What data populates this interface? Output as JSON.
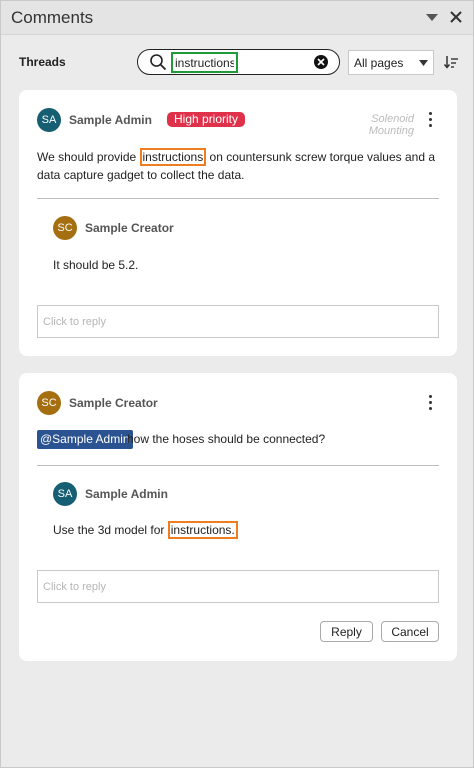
{
  "panel": {
    "title": "Comments",
    "collapse_icon": "triangle-down-icon",
    "close_icon": "close-icon"
  },
  "toolbar": {
    "threads_label": "Threads",
    "search_value": "instructions",
    "page_filter": "All pages"
  },
  "threads": [
    {
      "author_initials": "SA",
      "author": "Sample Admin",
      "priority": "High priority",
      "page_ref": "Solenoid Mounting",
      "text_before": "We should provide ",
      "text_match": "instructions",
      "text_after": " on countersunk screw torque values and a data capture gadget to collect the data.",
      "reply": {
        "author_initials": "SC",
        "author": "Sample Creator",
        "text": "It should be 5.2."
      },
      "reply_placeholder": "Click to reply"
    },
    {
      "author_initials": "SC",
      "author": "Sample Creator",
      "mention": "@Sample Admin",
      "text_after": "how the hoses should be connected?",
      "reply": {
        "author_initials": "SA",
        "author": "Sample Admin",
        "text_before": "Use the 3d model for ",
        "text_match": "instructions."
      },
      "reply_placeholder": "Click to reply",
      "reply_button": "Reply",
      "cancel_button": "Cancel"
    }
  ],
  "colors": {
    "admin_avatar": "#165e72",
    "creator_avatar": "#a46e11",
    "priority_badge": "#e0314b",
    "mention": "#2c5391",
    "search_highlight": "#1f9b3a",
    "match_highlight": "#ef7d22"
  }
}
